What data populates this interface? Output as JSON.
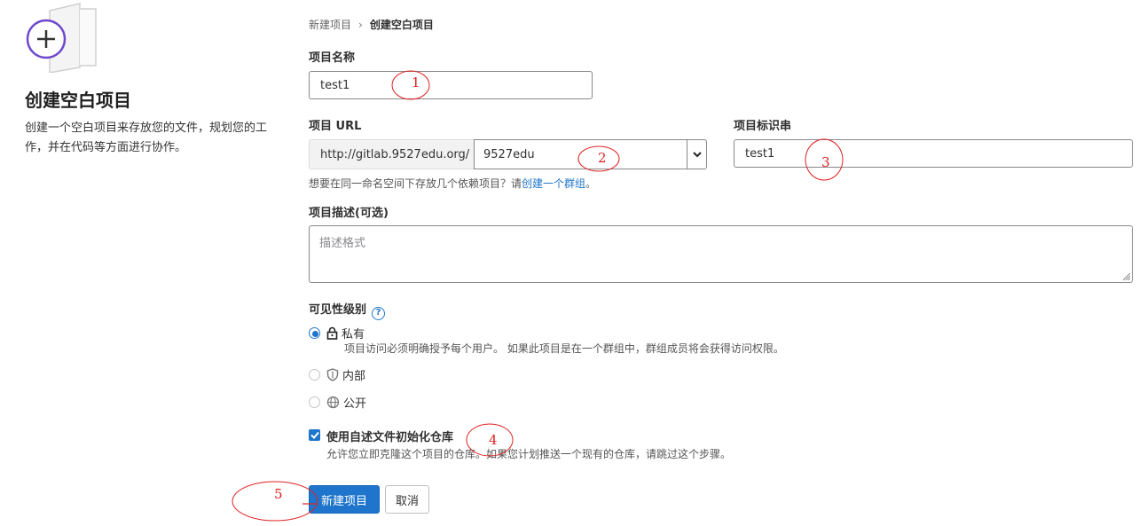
{
  "sidebar": {
    "title": "创建空白项目",
    "description": "创建一个空白项目来存放您的文件，规划您的工作，并在代码等方面进行协作。"
  },
  "breadcrumb": {
    "parent": "新建项目",
    "separator": "›",
    "current": "创建空白项目"
  },
  "form": {
    "project_name": {
      "label": "项目名称",
      "value": "test1"
    },
    "project_url": {
      "label": "项目 URL",
      "prefix": "http://gitlab.9527edu.org/",
      "namespace": "9527edu"
    },
    "project_slug": {
      "label": "项目标识串",
      "value": "test1"
    },
    "group_hint": {
      "text": "想要在同一命名空间下存放几个依赖项目？请",
      "link": "创建一个群组",
      "suffix": "。"
    },
    "description": {
      "label": "项目描述(可选)",
      "placeholder": "描述格式"
    },
    "visibility": {
      "label": "可见性级别",
      "help_icon": "?",
      "options": [
        {
          "label": "私有",
          "icon": "lock-icon",
          "checked": true,
          "description": "项目访问必须明确授予每个用户。 如果此项目是在一个群组中，群组成员将会获得访问权限。"
        },
        {
          "label": "内部",
          "icon": "shield-icon",
          "checked": false
        },
        {
          "label": "公开",
          "icon": "globe-icon",
          "checked": false
        }
      ]
    },
    "init_readme": {
      "label": "使用自述文件初始化仓库",
      "checked": true,
      "description": "允许您立即克隆这个项目的仓库。如果您计划推送一个现有的仓库，请跳过这个步骤。"
    },
    "buttons": {
      "create": "新建项目",
      "cancel": "取消"
    }
  },
  "annotations": [
    "1",
    "2",
    "3",
    "4",
    "5"
  ],
  "colors": {
    "primary": "#1f75cb",
    "annotation": "#e02020",
    "illustration": "#6e49cb"
  }
}
